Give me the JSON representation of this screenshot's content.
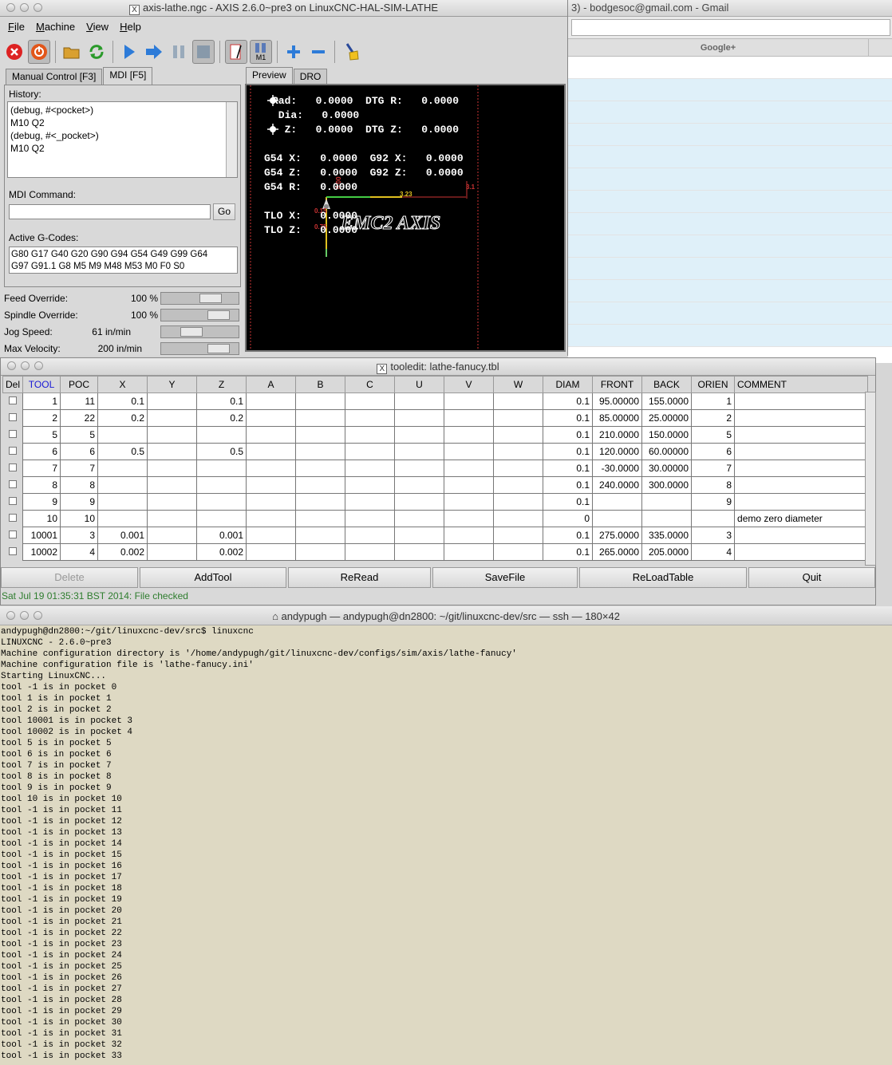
{
  "gmail": {
    "title": "3) - bodgesoc@gmail.com - Gmail",
    "bookmark": "Google+"
  },
  "axis": {
    "title": "axis-lathe.ngc - AXIS 2.6.0~pre3 on LinuxCNC-HAL-SIM-LATHE",
    "menu": [
      "File",
      "Machine",
      "View",
      "Help"
    ],
    "toolbar_icons": [
      "estop-icon",
      "power-icon",
      "open-file-icon",
      "reload-icon",
      "run-icon",
      "step-icon",
      "pause-icon",
      "stop-icon",
      "block-delete-icon",
      "optional-stop-icon",
      "zoom-in-icon",
      "zoom-out-icon",
      "clear-plot-icon"
    ],
    "toolbar_m1": "M1",
    "left_tabs": [
      "Manual Control [F3]",
      "MDI [F5]"
    ],
    "right_tabs": [
      "Preview",
      "DRO"
    ],
    "history_label": "History:",
    "history": [
      "(debug, #<pocket>)",
      "M10 Q2",
      "(debug, #<_pocket>)",
      "M10 Q2"
    ],
    "mdi_label": "MDI Command:",
    "mdi_value": "",
    "go_label": "Go",
    "active_label": "Active G-Codes:",
    "active_codes_1": "G80 G17 G40 G20 G90 G94 G54 G49 G99 G64",
    "active_codes_2": "G97 G91.1 G8 M5 M9 M48 M53 M0 F0 S0",
    "overrides": [
      {
        "label": "Feed Override:",
        "value": "100 %",
        "level": 0.7
      },
      {
        "label": "Spindle Override:",
        "value": "100 %",
        "level": 0.85
      },
      {
        "label": "Jog Speed:",
        "value": "61 in/min",
        "level": 0.35
      },
      {
        "label": "Max Velocity:",
        "value": "200 in/min",
        "level": 0.85
      }
    ],
    "dro": {
      "line1": "Rad:   0.0000  DTG R:   0.0000",
      "line2": " Dia:   0.0000",
      "line3": "  Z:   0.0000  DTG Z:   0.0000",
      "line4": "G54 X:   0.0000  G92 X:   0.0000",
      "line5": "G54 Z:   0.0000  G92 Z:   0.0000",
      "line6": "G54 R:   0.0000",
      "line7": "TLO X:   0.0000",
      "line8": "TLO Z:   0.0000"
    },
    "preview_logo": "EMC2 AXIS",
    "plot_labels": {
      "a": "3.23",
      "b": "3.1",
      "c": "0.15",
      "d": "0.75",
      "e": "0.00"
    }
  },
  "tooledit": {
    "title": "tooledit: lathe-fanucy.tbl",
    "headers": [
      "Del",
      "TOOL",
      "POC",
      "X",
      "Y",
      "Z",
      "A",
      "B",
      "C",
      "U",
      "V",
      "W",
      "DIAM",
      "FRONT",
      "BACK",
      "ORIEN",
      "COMMENT"
    ],
    "rows": [
      [
        "1",
        "11",
        "0.1",
        "",
        "0.1",
        "",
        "",
        "",
        "",
        "",
        "",
        "0.1",
        "95.00000",
        "155.0000",
        "1",
        ""
      ],
      [
        "2",
        "22",
        "0.2",
        "",
        "0.2",
        "",
        "",
        "",
        "",
        "",
        "",
        "0.1",
        "85.00000",
        "25.00000",
        "2",
        ""
      ],
      [
        "5",
        "5",
        "",
        "",
        "",
        "",
        "",
        "",
        "",
        "",
        "",
        "0.1",
        "210.0000",
        "150.0000",
        "5",
        ""
      ],
      [
        "6",
        "6",
        "0.5",
        "",
        "0.5",
        "",
        "",
        "",
        "",
        "",
        "",
        "0.1",
        "120.0000",
        "60.00000",
        "6",
        ""
      ],
      [
        "7",
        "7",
        "",
        "",
        "",
        "",
        "",
        "",
        "",
        "",
        "",
        "0.1",
        "-30.0000",
        "30.00000",
        "7",
        ""
      ],
      [
        "8",
        "8",
        "",
        "",
        "",
        "",
        "",
        "",
        "",
        "",
        "",
        "0.1",
        "240.0000",
        "300.0000",
        "8",
        ""
      ],
      [
        "9",
        "9",
        "",
        "",
        "",
        "",
        "",
        "",
        "",
        "",
        "",
        "0.1",
        "",
        "",
        "9",
        ""
      ],
      [
        "10",
        "10",
        "",
        "",
        "",
        "",
        "",
        "",
        "",
        "",
        "",
        "0",
        "",
        "",
        "",
        "demo zero diameter"
      ],
      [
        "10001",
        "3",
        "0.001",
        "",
        "0.001",
        "",
        "",
        "",
        "",
        "",
        "",
        "0.1",
        "275.0000",
        "335.0000",
        "3",
        ""
      ],
      [
        "10002",
        "4",
        "0.002",
        "",
        "0.002",
        "",
        "",
        "",
        "",
        "",
        "",
        "0.1",
        "265.0000",
        "205.0000",
        "4",
        ""
      ]
    ],
    "buttons": [
      "Delete",
      "AddTool",
      "ReRead",
      "SaveFile",
      "ReLoadTable",
      "Quit"
    ],
    "status": "Sat Jul 19 01:35:31 BST 2014: File checked"
  },
  "terminal": {
    "title": "andypugh — andypugh@dn2800: ~/git/linuxcnc-dev/src — ssh — 180×42",
    "lines": [
      "andypugh@dn2800:~/git/linuxcnc-dev/src$ linuxcnc",
      "LINUXCNC - 2.6.0~pre3",
      "Machine configuration directory is '/home/andypugh/git/linuxcnc-dev/configs/sim/axis/lathe-fanucy'",
      "Machine configuration file is 'lathe-fanucy.ini'",
      "Starting LinuxCNC...",
      "tool -1 is in pocket 0",
      "tool 1 is in pocket 1",
      "tool 2 is in pocket 2",
      "tool 10001 is in pocket 3",
      "tool 10002 is in pocket 4",
      "tool 5 is in pocket 5",
      "tool 6 is in pocket 6",
      "tool 7 is in pocket 7",
      "tool 8 is in pocket 8",
      "tool 9 is in pocket 9",
      "tool 10 is in pocket 10",
      "tool -1 is in pocket 11",
      "tool -1 is in pocket 12",
      "tool -1 is in pocket 13",
      "tool -1 is in pocket 14",
      "tool -1 is in pocket 15",
      "tool -1 is in pocket 16",
      "tool -1 is in pocket 17",
      "tool -1 is in pocket 18",
      "tool -1 is in pocket 19",
      "tool -1 is in pocket 20",
      "tool -1 is in pocket 21",
      "tool -1 is in pocket 22",
      "tool -1 is in pocket 23",
      "tool -1 is in pocket 24",
      "tool -1 is in pocket 25",
      "tool -1 is in pocket 26",
      "tool -1 is in pocket 27",
      "tool -1 is in pocket 28",
      "tool -1 is in pocket 29",
      "tool -1 is in pocket 30",
      "tool -1 is in pocket 31",
      "tool -1 is in pocket 32",
      "tool -1 is in pocket 33"
    ]
  }
}
